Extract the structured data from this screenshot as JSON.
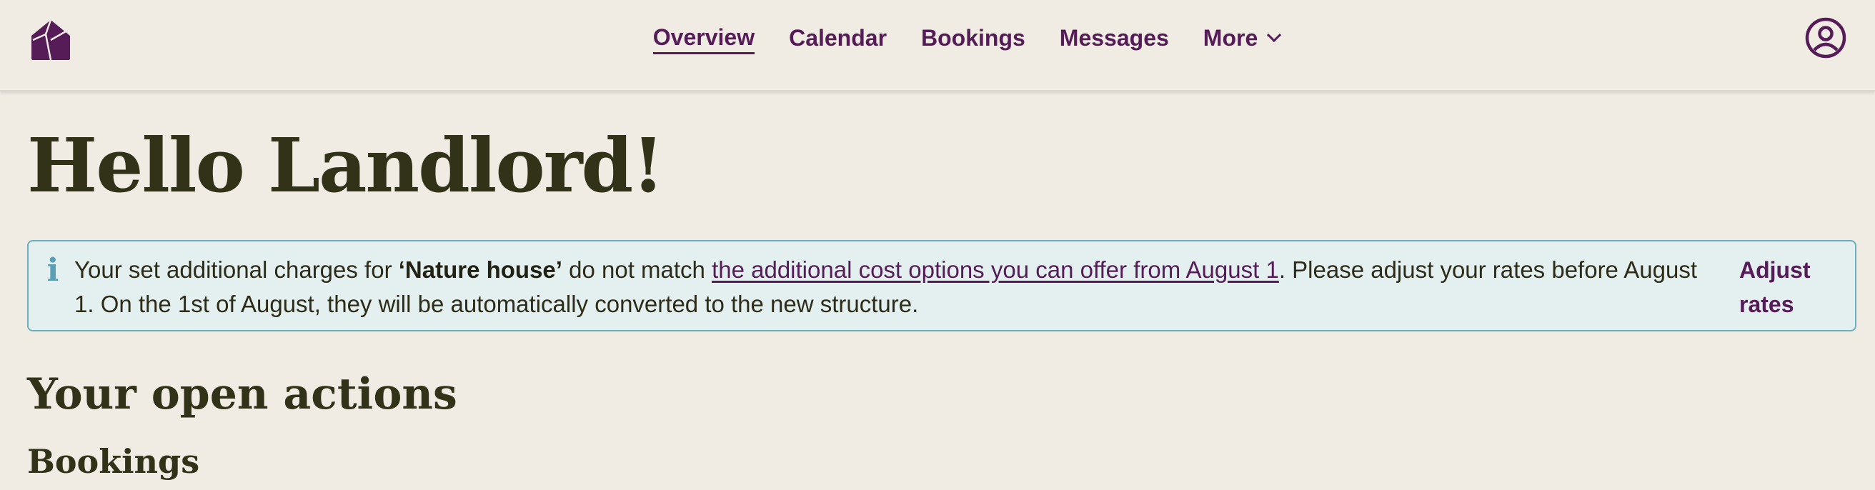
{
  "nav": {
    "items": [
      {
        "label": "Overview"
      },
      {
        "label": "Calendar"
      },
      {
        "label": "Bookings"
      },
      {
        "label": "Messages"
      },
      {
        "label": "More"
      }
    ]
  },
  "greeting": "Hello Landlord!",
  "notice": {
    "part1": "Your set additional charges for ",
    "house": "‘Nature house’",
    "part2": " do not match ",
    "link": "the additional cost options you can offer from August 1",
    "part3": ". Please adjust your rates before August 1. On the 1st of August, they will be automatically converted to the new structure.",
    "action": "Adjust rates"
  },
  "section_title": "Your open actions",
  "sub_title": "Bookings",
  "colors": {
    "brand": "#551c57",
    "background": "#f0ece4",
    "notice_bg": "#e4f0f0",
    "notice_border": "#6aaec0"
  }
}
